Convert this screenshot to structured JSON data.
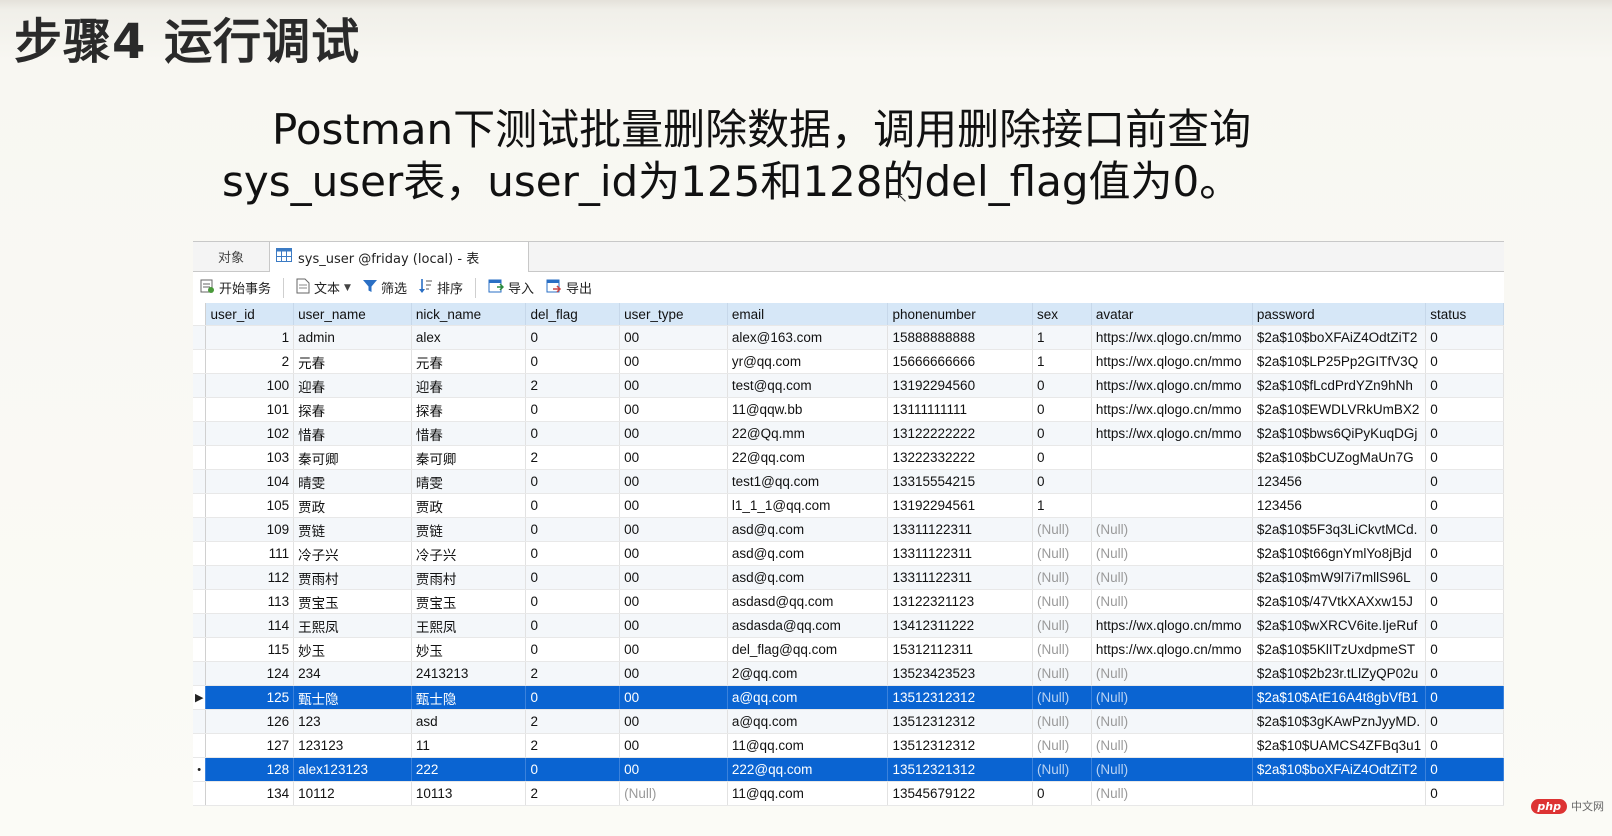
{
  "heading": "步骤4 运行调试",
  "description": {
    "line1": "Postman下测试批量删除数据，调用删除接口前查询",
    "line2": "sys_user表，user_id为125和128的del_flag值为0。"
  },
  "window": {
    "tabs": {
      "objects": "对象",
      "table": "sys_user @friday (local) - 表"
    },
    "toolbar": {
      "begin_transaction": "开始事务",
      "text": "文本",
      "filter": "筛选",
      "sort": "排序",
      "import": "导入",
      "export": "导出"
    }
  },
  "grid": {
    "columns": [
      "user_id",
      "user_name",
      "nick_name",
      "del_flag",
      "user_type",
      "email",
      "phonenumber",
      "sex",
      "avatar",
      "password",
      "status"
    ],
    "rows": [
      {
        "m": "",
        "c": [
          "1",
          "admin",
          "alex",
          "0",
          "00",
          "alex@163.com",
          "15888888888",
          "1",
          "https://wx.qlogo.cn/mmo",
          "$2a$10$boXFAiZ4OdtZiT2",
          "0"
        ]
      },
      {
        "m": "",
        "c": [
          "2",
          "元春",
          "元春",
          "0",
          "00",
          "yr@qq.com",
          "15666666666",
          "1",
          "https://wx.qlogo.cn/mmo",
          "$2a$10$LP25Pp2GITfV3Q",
          "0"
        ]
      },
      {
        "m": "",
        "c": [
          "100",
          "迎春",
          "迎春",
          "2",
          "00",
          "test@qq.com",
          "13192294560",
          "0",
          "https://wx.qlogo.cn/mmo",
          "$2a$10$fLcdPrdYZn9hNh",
          "0"
        ]
      },
      {
        "m": "",
        "c": [
          "101",
          "探春",
          "探春",
          "0",
          "00",
          "11@qqw.bb",
          "13111111111",
          "0",
          "https://wx.qlogo.cn/mmo",
          "$2a$10$EWDLVRkUmBX2",
          "0"
        ]
      },
      {
        "m": "",
        "c": [
          "102",
          "惜春",
          "惜春",
          "0",
          "00",
          "22@Qq.mm",
          "13122222222",
          "0",
          "https://wx.qlogo.cn/mmo",
          "$2a$10$bws6QiPyKuqDGj",
          "0"
        ]
      },
      {
        "m": "",
        "c": [
          "103",
          "秦可卿",
          "秦可卿",
          "2",
          "00",
          "22@qq.com",
          "13222332222",
          "0",
          "",
          "$2a$10$bCUZogMaUn7G",
          "0"
        ]
      },
      {
        "m": "",
        "c": [
          "104",
          "晴雯",
          "晴雯",
          "0",
          "00",
          "test1@qq.com",
          "13315554215",
          "0",
          "",
          "123456",
          "0"
        ]
      },
      {
        "m": "",
        "c": [
          "105",
          "贾政",
          "贾政",
          "0",
          "00",
          "l1_1_1@qq.com",
          "13192294561",
          "1",
          "",
          "123456",
          "0"
        ]
      },
      {
        "m": "",
        "c": [
          "109",
          "贾链",
          "贾链",
          "0",
          "00",
          "asd@q.com",
          "13311122311",
          "(Null)",
          "(Null)",
          "$2a$10$5F3q3LiCkvtMCd.",
          "0"
        ]
      },
      {
        "m": "",
        "c": [
          "111",
          "冷子兴",
          "冷子兴",
          "0",
          "00",
          "asd@q.com",
          "13311122311",
          "(Null)",
          "(Null)",
          "$2a$10$t66gnYmlYo8jBjd",
          "0"
        ]
      },
      {
        "m": "",
        "c": [
          "112",
          "贾雨村",
          "贾雨村",
          "0",
          "00",
          "asd@q.com",
          "13311122311",
          "(Null)",
          "(Null)",
          "$2a$10$mW9l7i7mllS96L",
          "0"
        ]
      },
      {
        "m": "",
        "c": [
          "113",
          "贾宝玉",
          "贾宝玉",
          "0",
          "00",
          "asdasd@qq.com",
          "13122321123",
          "(Null)",
          "(Null)",
          "$2a$10$/47VtkXAXxw15J",
          "0"
        ]
      },
      {
        "m": "",
        "c": [
          "114",
          "王熙凤",
          "王熙凤",
          "0",
          "00",
          "asdasda@qq.com",
          "13412311222",
          "(Null)",
          "https://wx.qlogo.cn/mmo",
          "$2a$10$wXRCV6ite.IjeRuf",
          "0"
        ]
      },
      {
        "m": "",
        "c": [
          "115",
          "妙玉",
          "妙玉",
          "0",
          "00",
          "del_flag@qq.com",
          "15312112311",
          "(Null)",
          "https://wx.qlogo.cn/mmo",
          "$2a$10$5KlITzUxdpmeST",
          "0"
        ]
      },
      {
        "m": "",
        "c": [
          "124",
          "234",
          "2413213",
          "2",
          "00",
          "2@qq.com",
          "13523423523",
          "(Null)",
          "(Null)",
          "$2a$10$2b23r.tLlZyQP02u",
          "0"
        ]
      },
      {
        "m": "▶",
        "c": [
          "125",
          "甄士隐",
          "甄士隐",
          "0",
          "00",
          "a@qq.com",
          "13512312312",
          "(Null)",
          "(Null)",
          "$2a$10$AtE16A4t8gbVfB1",
          "0"
        ],
        "sel": true
      },
      {
        "m": "",
        "c": [
          "126",
          "123",
          "asd",
          "2",
          "00",
          "a@qq.com",
          "13512312312",
          "(Null)",
          "(Null)",
          "$2a$10$3gKAwPznJyyMD.",
          "0"
        ]
      },
      {
        "m": "",
        "c": [
          "127",
          "123123",
          "11",
          "2",
          "00",
          "11@qq.com",
          "13512312312",
          "(Null)",
          "(Null)",
          "$2a$10$UAMCS4ZFBq3u1",
          "0"
        ]
      },
      {
        "m": "•",
        "c": [
          "128",
          "alex123123",
          "222",
          "0",
          "00",
          "222@qq.com",
          "13512321312",
          "(Null)",
          "(Null)",
          "$2a$10$boXFAiZ4OdtZiT2",
          "0"
        ],
        "sel": true
      },
      {
        "m": "",
        "c": [
          "134",
          "10112",
          "10113",
          "2",
          "(Null)",
          "11@qq.com",
          "13545679122",
          "0",
          "(Null)",
          "",
          "0"
        ]
      }
    ]
  },
  "watermark": {
    "logo": "php",
    "site": "中文网"
  }
}
